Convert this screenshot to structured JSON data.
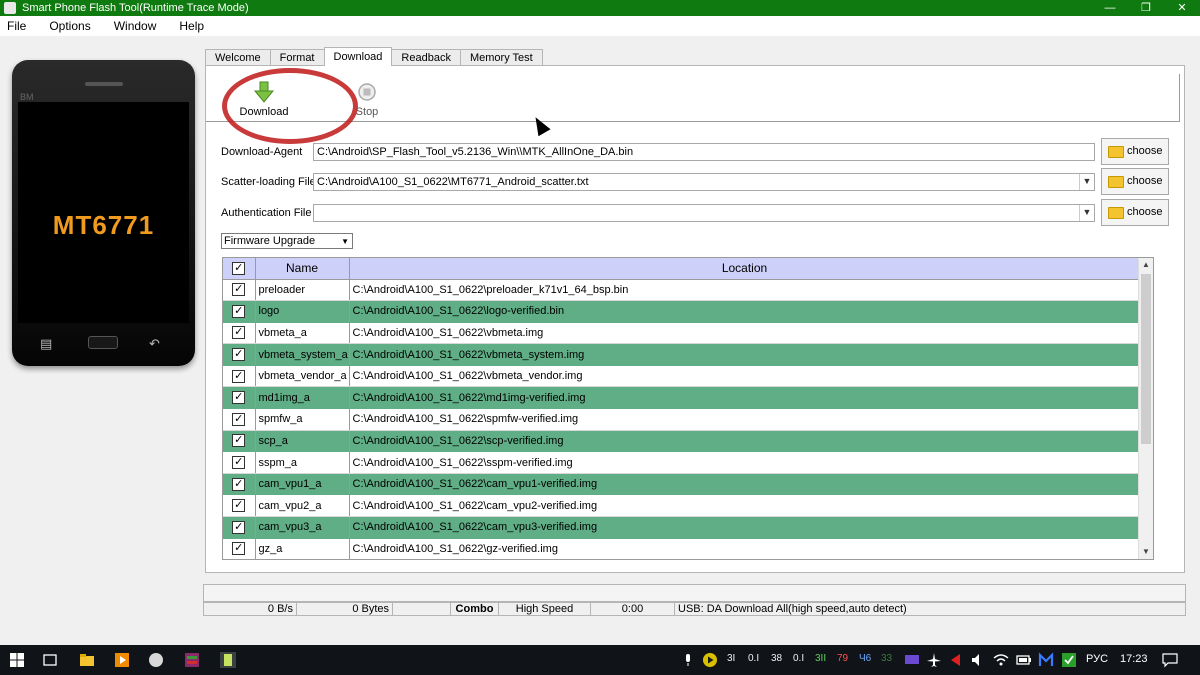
{
  "window": {
    "title": "Smart Phone Flash Tool(Runtime Trace Mode)"
  },
  "menu": [
    "File",
    "Options",
    "Window",
    "Help"
  ],
  "phone": {
    "brand": "BM",
    "chip": "MT6771"
  },
  "tabs": [
    "Welcome",
    "Format",
    "Download",
    "Readback",
    "Memory Test"
  ],
  "toolbar": {
    "download_label": "Download",
    "stop_label": "Stop"
  },
  "fields": {
    "download_agent": {
      "label": "Download-Agent",
      "value": "C:\\Android\\SP_Flash_Tool_v5.2136_Win\\\\MTK_AllInOne_DA.bin",
      "button": "choose"
    },
    "scatter": {
      "label": "Scatter-loading File",
      "value": "C:\\Android\\A100_S1_0622\\MT6771_Android_scatter.txt",
      "button": "choose"
    },
    "auth": {
      "label": "Authentication File",
      "value": "",
      "button": "choose"
    }
  },
  "mode": "Firmware Upgrade",
  "table": {
    "headers": [
      "Name",
      "Location"
    ],
    "rows": [
      {
        "name": "preloader",
        "location": "C:\\Android\\A100_S1_0622\\preloader_k71v1_64_bsp.bin"
      },
      {
        "name": "logo",
        "location": "C:\\Android\\A100_S1_0622\\logo-verified.bin"
      },
      {
        "name": "vbmeta_a",
        "location": "C:\\Android\\A100_S1_0622\\vbmeta.img"
      },
      {
        "name": "vbmeta_system_a",
        "location": "C:\\Android\\A100_S1_0622\\vbmeta_system.img"
      },
      {
        "name": "vbmeta_vendor_a",
        "location": "C:\\Android\\A100_S1_0622\\vbmeta_vendor.img"
      },
      {
        "name": "md1img_a",
        "location": "C:\\Android\\A100_S1_0622\\md1img-verified.img"
      },
      {
        "name": "spmfw_a",
        "location": "C:\\Android\\A100_S1_0622\\spmfw-verified.img"
      },
      {
        "name": "scp_a",
        "location": "C:\\Android\\A100_S1_0622\\scp-verified.img"
      },
      {
        "name": "sspm_a",
        "location": "C:\\Android\\A100_S1_0622\\sspm-verified.img"
      },
      {
        "name": "cam_vpu1_a",
        "location": "C:\\Android\\A100_S1_0622\\cam_vpu1-verified.img"
      },
      {
        "name": "cam_vpu2_a",
        "location": "C:\\Android\\A100_S1_0622\\cam_vpu2-verified.img"
      },
      {
        "name": "cam_vpu3_a",
        "location": "C:\\Android\\A100_S1_0622\\cam_vpu3-verified.img"
      },
      {
        "name": "gz_a",
        "location": "C:\\Android\\A100_S1_0622\\gz-verified.img"
      }
    ]
  },
  "status": {
    "speed": "0 B/s",
    "bytes": "0 Bytes",
    "blank": "",
    "port": "Combo",
    "mode": "High Speed",
    "time": "0:00",
    "message": "USB: DA Download All(high speed,auto detect)"
  },
  "taskbar": {
    "tray_values": [
      "3I",
      "0.I",
      "38",
      "0.I",
      "3II",
      "79",
      "Ч6",
      "33"
    ],
    "language": "РУС",
    "time": "17:23"
  },
  "colors": {
    "titlebar": "#0f7a0f",
    "row_highlight": "#5fae86",
    "header": "#cdd0f8",
    "annotation": "#c01818"
  }
}
